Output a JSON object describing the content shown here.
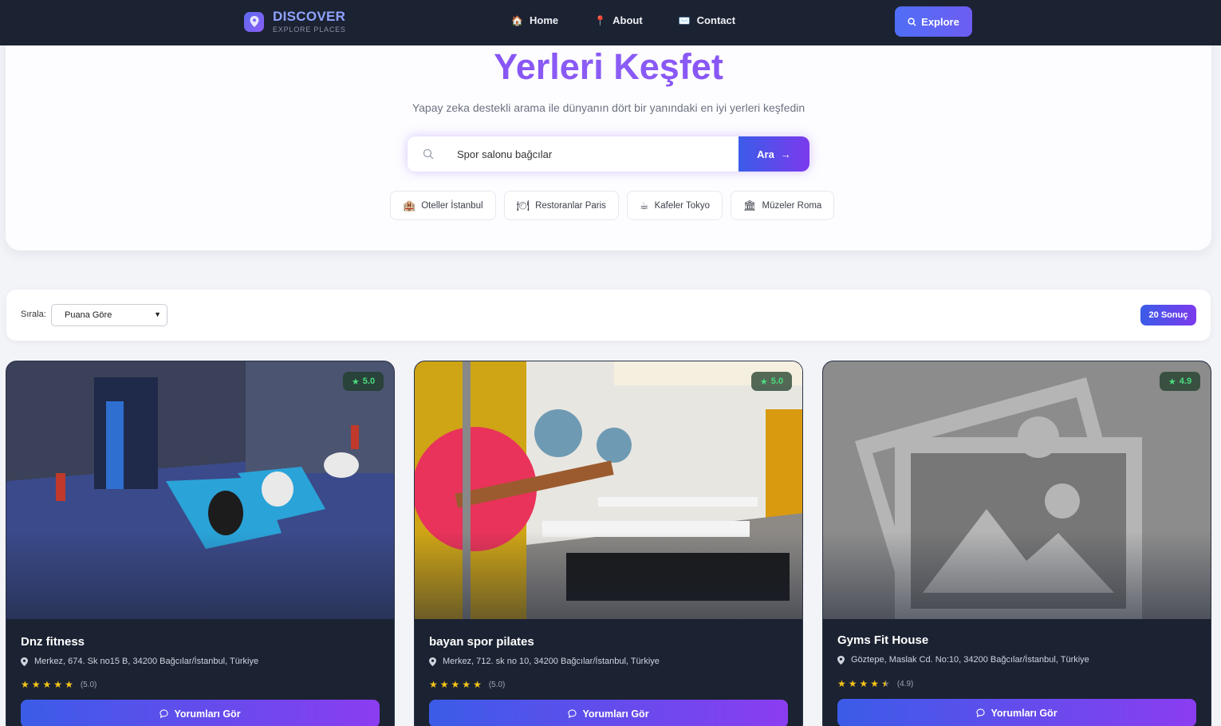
{
  "nav": {
    "brand_title": "DISCOVER",
    "brand_sub": "EXPLORE PLACES",
    "links": [
      {
        "label": "Home",
        "icon": "🏠"
      },
      {
        "label": "About",
        "icon": "📍"
      },
      {
        "label": "Contact",
        "icon": "✉️"
      }
    ],
    "explore_label": "Explore"
  },
  "hero": {
    "title": "Yerleri Keşfet",
    "subtitle": "Yapay zeka destekli arama ile dünyanın dört bir yanındaki en iyi yerleri keşfedin",
    "search_value": "Spor salonu bağcılar",
    "search_button": "Ara",
    "chips": [
      {
        "label": "Oteller İstanbul",
        "icon": "🏨"
      },
      {
        "label": "Restoranlar Paris",
        "icon": "🍽"
      },
      {
        "label": "Kafeler Tokyo",
        "icon": "☕"
      },
      {
        "label": "Müzeler Roma",
        "icon": "🏛"
      }
    ]
  },
  "sort": {
    "label": "Sırala:",
    "selected": "Puana Göre",
    "result_count": "20 Sonuç"
  },
  "cards": [
    {
      "name": "Dnz fitness",
      "address": "Merkez, 674. Sk no15 B, 34200 Bağcılar/İstanbul, Türkiye",
      "rating_badge": "5.0",
      "rating_text": "(5.0)",
      "rating": 5.0,
      "button": "Yorumları Gör"
    },
    {
      "name": "bayan spor pilates",
      "address": "Merkez, 712. sk no 10, 34200 Bağcılar/İstanbul, Türkiye",
      "rating_badge": "5.0",
      "rating_text": "(5.0)",
      "rating": 5.0,
      "button": "Yorumları Gör"
    },
    {
      "name": "Gyms Fit House",
      "address": "Göztepe, Maslak Cd. No:10, 34200 Bağcılar/İstanbul, Türkiye",
      "rating_badge": "4.9",
      "rating_text": "(4.9)",
      "rating": 4.9,
      "button": "Yorumları Gör"
    }
  ],
  "colors": {
    "nav_bg": "#1b2232",
    "accent_start": "#3b5ce8",
    "accent_end": "#8b3df0",
    "title_purple": "#7c3aed",
    "rating_green": "#4ade80",
    "star_yellow": "#f5c518"
  }
}
